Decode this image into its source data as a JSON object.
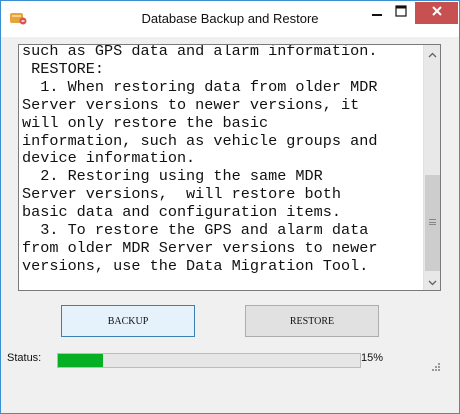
{
  "window": {
    "title": "Database Backup and Restore",
    "controls": {
      "minimize": "minimize",
      "maximize": "maximize",
      "close": "close"
    }
  },
  "textbox": {
    "lines": [
      "such as GPS data and alarm information.",
      " RESTORE:",
      "  1. When restoring data from older MDR",
      "Server versions to newer versions, it",
      "will only restore the basic",
      "information, such as vehicle groups and",
      "device information.",
      "  2. Restoring using the same MDR",
      "Server versions,  will restore both",
      "basic data and configuration items.",
      "  3. To restore the GPS and alarm data",
      "from older MDR Server versions to newer",
      "versions, use the Data Migration Tool."
    ]
  },
  "buttons": {
    "backup": "BACKUP",
    "restore": "RESTORE"
  },
  "status": {
    "label": "Status:",
    "progress_fraction": 0.15,
    "progress_text": "15%"
  },
  "colors": {
    "accent_border": "#3a8fd0",
    "close_button": "#c75050",
    "progress_fill": "#06b025"
  }
}
